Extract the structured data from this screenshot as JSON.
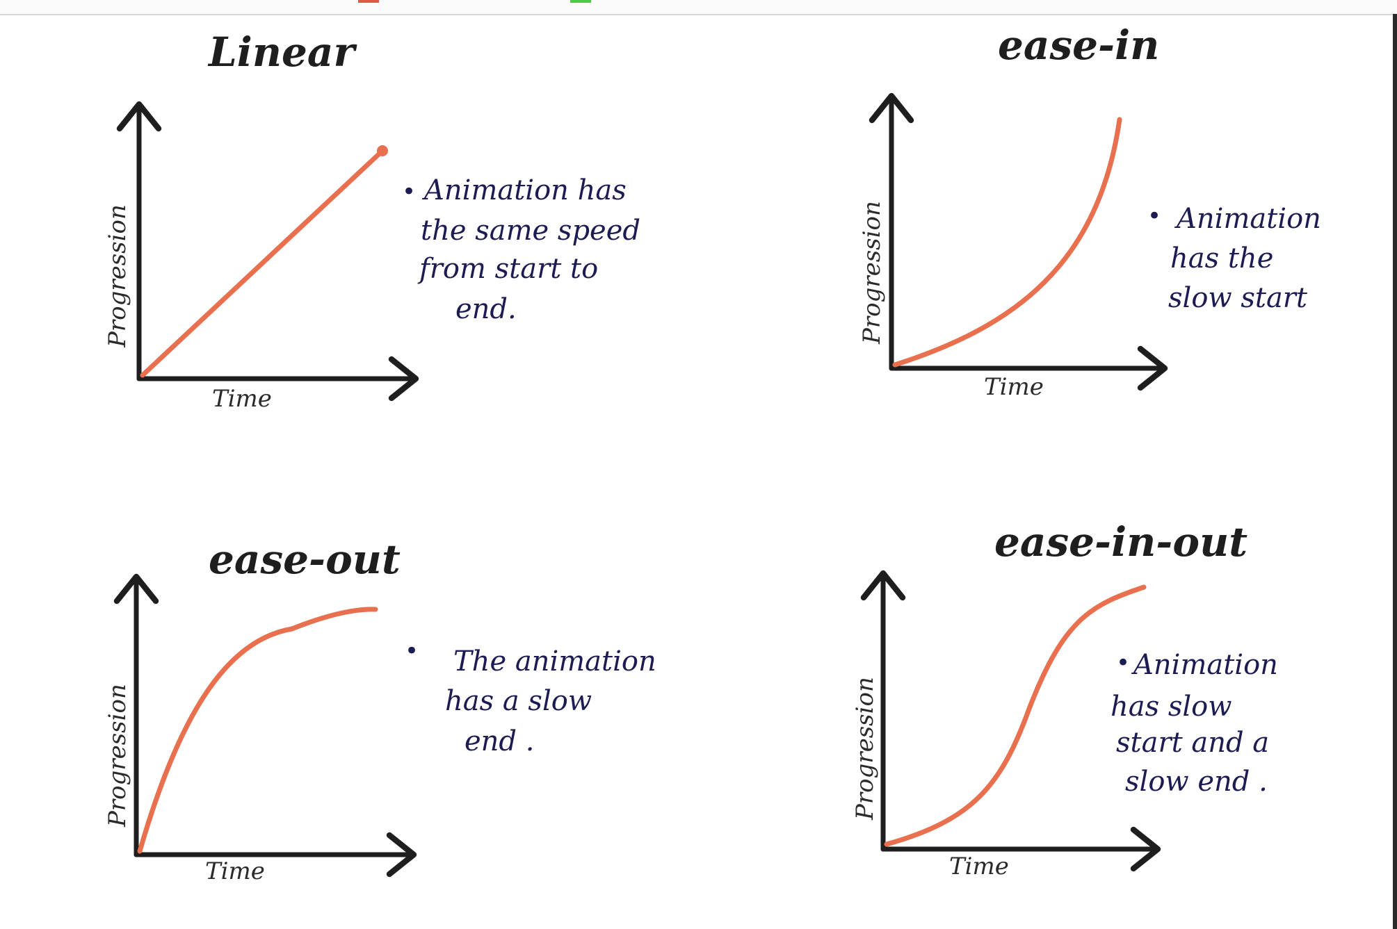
{
  "accent_color": "#e8704e",
  "panels": {
    "linear": {
      "title": "Linear",
      "ylabel": "Progression",
      "xlabel": "Time",
      "bullet": "•",
      "note_lines": [
        "Animation has",
        "the same speed",
        "from start to",
        "end."
      ]
    },
    "ease_in": {
      "title": "ease-in",
      "ylabel": "Progression",
      "xlabel": "Time",
      "bullet": "•",
      "note_lines": [
        "Animation",
        "has the",
        "slow start"
      ]
    },
    "ease_out": {
      "title": "ease-out",
      "ylabel": "Progression",
      "xlabel": "Time",
      "bullet": "•",
      "note_lines": [
        "The animation",
        "has a slow",
        "end ."
      ]
    },
    "ease_in_out": {
      "title": "ease-in-out",
      "ylabel": "Progression",
      "xlabel": "Time",
      "bullet": "•",
      "note_lines": [
        "Animation",
        "has slow",
        "start and a",
        "slow end ."
      ]
    }
  }
}
